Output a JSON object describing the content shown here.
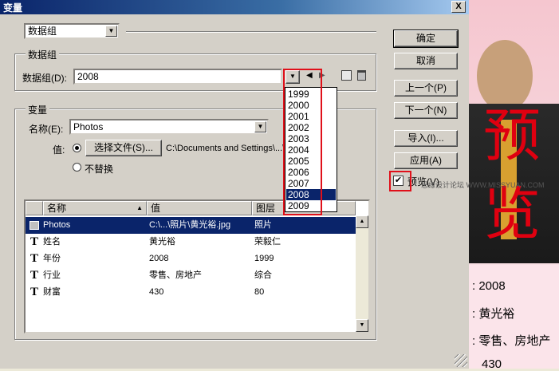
{
  "window": {
    "title": "变量",
    "close_glyph": "X"
  },
  "top_select": {
    "value": "数据组"
  },
  "dataset_group": {
    "legend": "数据组",
    "label": "数据组(D):",
    "value": "2008",
    "dropdown_options": [
      "1999",
      "2000",
      "2001",
      "2002",
      "2003",
      "2004",
      "2005",
      "2006",
      "2007",
      "2008",
      "2009"
    ],
    "selected_option": "2008"
  },
  "variable_group": {
    "legend": "变量",
    "name_label": "名称(E):",
    "name_value": "Photos",
    "value_label": "值:",
    "choose_file_button": "选择文件(S)...",
    "file_path": "C:\\Documents and Settings\\...\\...\\...jpg",
    "no_replace_label": "不替换"
  },
  "table": {
    "headers": [
      "名称",
      "值",
      "图层"
    ],
    "sort_glyph": "▲",
    "rows": [
      {
        "icon": "image",
        "name": "Photos",
        "value": "C:\\...\\照片\\黄光裕.jpg",
        "layer": "照片",
        "selected": true
      },
      {
        "icon": "T",
        "name": "姓名",
        "value": "黄光裕",
        "layer": "荣毅仁"
      },
      {
        "icon": "T",
        "name": "年份",
        "value": "2008",
        "layer": "1999"
      },
      {
        "icon": "T",
        "name": "行业",
        "value": "零售、房地产",
        "layer": "综合"
      },
      {
        "icon": "T",
        "name": "财富",
        "value": "430",
        "layer": "80"
      }
    ]
  },
  "buttons": {
    "ok": "确定",
    "cancel": "取消",
    "prev": "上一个(P)",
    "next": "下一个(N)",
    "import": "导入(I)...",
    "apply": "应用(A)"
  },
  "preview": {
    "label": "预览(V)",
    "checked": true
  },
  "watermark": "思缘设计论坛 WWW.MISSYUAN.COM",
  "background": {
    "big_chars": [
      "预",
      "览"
    ],
    "info_lines": [
      ": 2008",
      ": 黄光裕",
      ": 零售、房地产",
      "430"
    ]
  }
}
